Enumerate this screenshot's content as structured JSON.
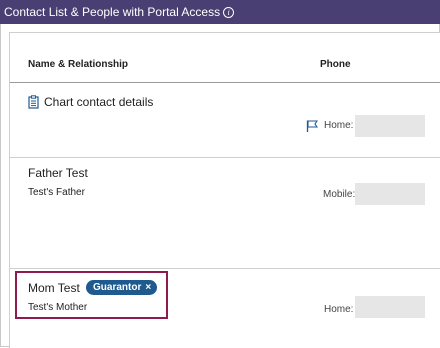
{
  "title": "Contact List & People with Portal Access",
  "info_glyph": "i",
  "columns": {
    "name": "Name & Relationship",
    "phone": "Phone"
  },
  "chart_link": "Chart contact details",
  "contacts": [
    {
      "name": "Father Test",
      "relationship": "Test's Father",
      "phone_label": "Mobile:",
      "phone_value": ""
    },
    {
      "name": "Mom Test",
      "badge": "Guarantor",
      "badge_close": "×",
      "relationship": "Test's Mother",
      "phone_label": "Home:",
      "phone_value": ""
    }
  ],
  "chart_phone_label": "Home:",
  "colors": {
    "titlebar": "#4a3f73",
    "badge": "#1f5a8e",
    "highlight": "#8e1b4f"
  }
}
